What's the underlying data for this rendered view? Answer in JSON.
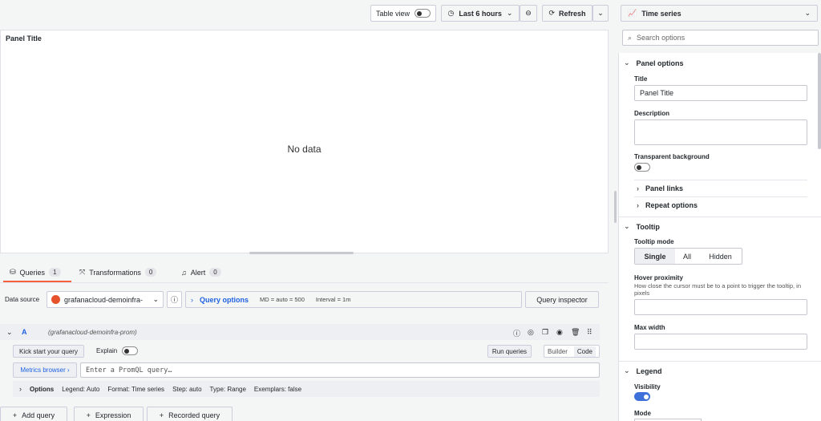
{
  "toolbar": {
    "table_view_label": "Table view",
    "time_range_label": "Last 6 hours",
    "refresh_label": "Refresh"
  },
  "panel": {
    "title": "Panel Title",
    "no_data": "No data"
  },
  "query_tabs": [
    {
      "label": "Queries",
      "count": "1"
    },
    {
      "label": "Transformations",
      "count": "0"
    },
    {
      "label": "Alert",
      "count": "0"
    }
  ],
  "datasource": {
    "label": "Data source",
    "selected": "grafanacloud-demoinfra-",
    "query_options_label": "Query options",
    "md_info": "MD = auto = 500",
    "interval_info": "Interval = 1m",
    "query_inspector_label": "Query inspector"
  },
  "query_row": {
    "ref_id": "A",
    "datasource_name": "(grafanacloud-demoinfra-prom)",
    "kick_start_label": "Kick start your query",
    "explain_label": "Explain",
    "run_queries_label": "Run queries",
    "builder_label": "Builder",
    "code_label": "Code",
    "metrics_browser_label": "Metrics browser ›",
    "promql_placeholder": "Enter a PromQL query…",
    "options_label": "Options",
    "options_summary": {
      "legend": "Legend: Auto",
      "format": "Format: Time series",
      "step": "Step: auto",
      "type": "Type: Range",
      "exemplars": "Exemplars: false"
    }
  },
  "bottom_buttons": {
    "add_query": "Add query",
    "expression": "Expression",
    "recorded_query": "Recorded query"
  },
  "sidebar": {
    "viz_label": "Time series",
    "search_placeholder": "Search options",
    "panel_options_head": "Panel options",
    "title_label": "Title",
    "title_value": "Panel Title",
    "description_label": "Description",
    "transparent_bg_label": "Transparent background",
    "panel_links_label": "Panel links",
    "repeat_options_label": "Repeat options",
    "tooltip_head": "Tooltip",
    "tooltip_mode_label": "Tooltip mode",
    "tooltip_modes": [
      "Single",
      "All",
      "Hidden"
    ],
    "hover_proximity_label": "Hover proximity",
    "hover_proximity_desc": "How close the cursor must be to a point to trigger the tooltip, in pixels",
    "max_width_label": "Max width",
    "legend_head": "Legend",
    "visibility_label": "Visibility",
    "mode_label": "Mode"
  },
  "colors": {
    "accent": "#3d71d9",
    "tab_active_underline": "#f55f3e",
    "link_blue": "#1f62e0"
  }
}
